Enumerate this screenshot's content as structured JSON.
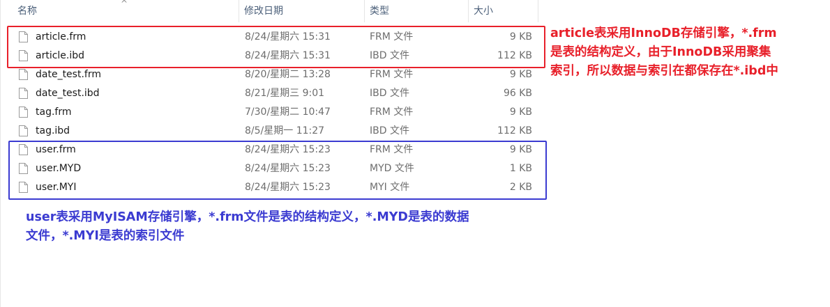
{
  "columns": {
    "name": "名称",
    "modified": "修改日期",
    "type": "类型",
    "size": "大小"
  },
  "sort_indicator": "^",
  "files": [
    {
      "name": "article.frm",
      "modified": "8/24/星期六 15:31",
      "type": "FRM 文件",
      "size": "9 KB"
    },
    {
      "name": "article.ibd",
      "modified": "8/24/星期六 15:31",
      "type": "IBD 文件",
      "size": "112 KB"
    },
    {
      "name": "date_test.frm",
      "modified": "8/20/星期二 13:28",
      "type": "FRM 文件",
      "size": "9 KB"
    },
    {
      "name": "date_test.ibd",
      "modified": "8/21/星期三 9:01",
      "type": "IBD 文件",
      "size": "96 KB"
    },
    {
      "name": "tag.frm",
      "modified": "7/30/星期二 10:47",
      "type": "FRM 文件",
      "size": "9 KB"
    },
    {
      "name": "tag.ibd",
      "modified": "8/5/星期一 11:27",
      "type": "IBD 文件",
      "size": "112 KB"
    },
    {
      "name": "user.frm",
      "modified": "8/24/星期六 15:23",
      "type": "FRM 文件",
      "size": "9 KB"
    },
    {
      "name": "user.MYD",
      "modified": "8/24/星期六 15:23",
      "type": "MYD 文件",
      "size": "1 KB"
    },
    {
      "name": "user.MYI",
      "modified": "8/24/星期六 15:23",
      "type": "MYI 文件",
      "size": "2 KB"
    }
  ],
  "annotations": {
    "innodb": {
      "line1": "article表采用InnoDB存储引擎，*.frm",
      "line2": "是表的结构定义，由于InnoDB采用聚集",
      "line3": "索引，所以数据与索引在都保存在*.ibd中",
      "color": "#e8202a"
    },
    "myisam": {
      "line1": "user表采用MyISAM存储引擎，*.frm文件是表的结构定义，*.MYD是表的数据",
      "line2": "文件，*.MYI是表的索引文件",
      "color": "#3b3bd1"
    }
  },
  "icons": {
    "file": "document-icon",
    "sort": "sort-ascending-icon"
  }
}
